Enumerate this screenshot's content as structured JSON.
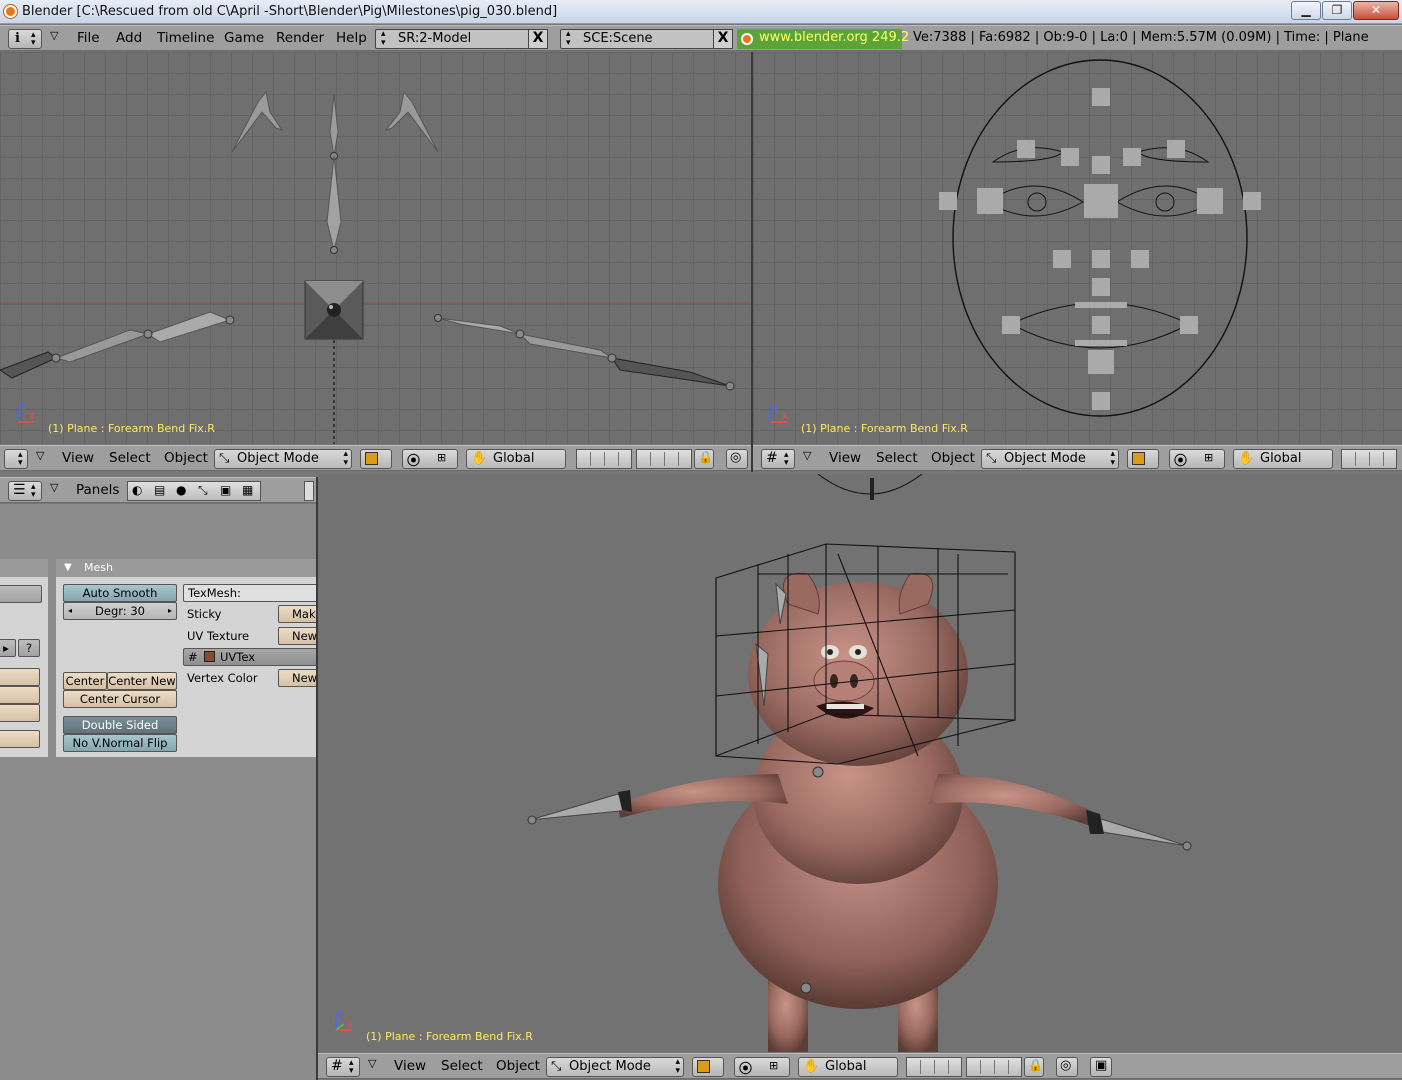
{
  "window": {
    "title": "Blender [C:\\Rescued from old C\\April -Short\\Blender\\Pig\\Milestones\\pig_030.blend]",
    "min_label": "▁",
    "max_label": "❐",
    "close_label": "✕"
  },
  "top_header": {
    "menus": [
      "File",
      "Add",
      "Timeline",
      "Game",
      "Render",
      "Help"
    ],
    "screen_field": "SR:2-Model",
    "scene_field": "SCE:Scene",
    "x_label": "X",
    "url": "www.blender.org 249.2",
    "stats": "Ve:7388 | Fa:6982 | Ob:9-0 | La:0  | Mem:5.57M (0.09M)  | Time: | Plane"
  },
  "viewport_header": {
    "menus": [
      "View",
      "Select",
      "Object"
    ],
    "mode": "Object Mode",
    "orientation": "Global"
  },
  "viewport_label": "(1) Plane : Forearm Bend Fix.R",
  "buttons_header": {
    "panels_label": "Panels"
  },
  "mesh_panel": {
    "tab_title": "Mesh",
    "auto_smooth": "Auto Smooth",
    "degr": "Degr: 30",
    "texmesh": "TexMesh:",
    "sticky": "Sticky",
    "make": "Make",
    "uv_texture": "UV Texture",
    "new": "New",
    "uvtex": "UVTex",
    "vertex_color": "Vertex Color",
    "center": "Center",
    "center_new": "Center New",
    "center_cursor": "Center Cursor",
    "double_sided": "Double Sided",
    "no_vnormal_flip": "No V.Normal Flip",
    "question": "?"
  },
  "colors": {
    "header": "#9e9e9e",
    "viewport_bg": "#6f6f6f",
    "label_yellow": "#ffea60",
    "url_green": "#5ca43a"
  }
}
